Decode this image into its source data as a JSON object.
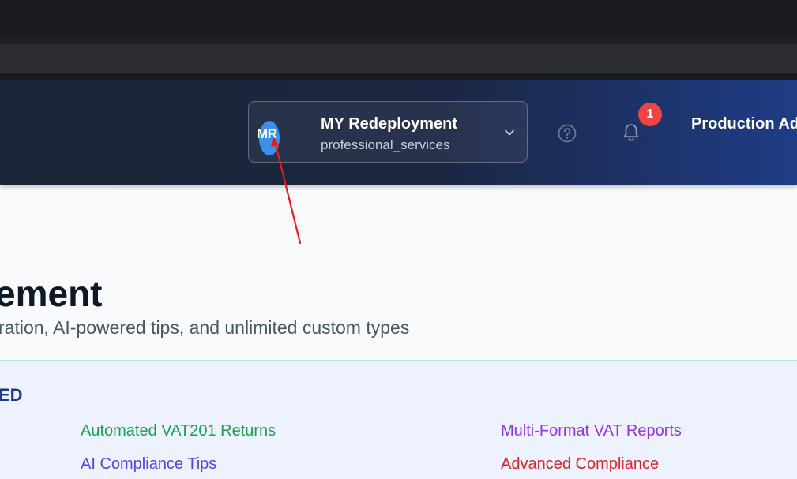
{
  "header": {
    "org_switcher": {
      "avatar_initials": "MR",
      "name": "MY Redeployment",
      "type": "professional_services"
    },
    "notifications": {
      "count": "1"
    },
    "environment_label": "Production Ad",
    "icons": [
      "help-icon",
      "bell-icon",
      "chevron-down-icon"
    ]
  },
  "main": {
    "title": "ement",
    "subtitle": "ration, AI-powered tips, and unlimited custom types",
    "features": {
      "heading": "ED",
      "items": [
        {
          "label": "Automated VAT201 Returns",
          "color": "#16a34a"
        },
        {
          "label": "Multi-Format VAT Reports",
          "color": "#9333ea"
        },
        {
          "label": "AI Compliance Tips",
          "color": "#4f46e5"
        },
        {
          "label": "Advanced Compliance",
          "color": "#dc2626"
        }
      ]
    }
  },
  "colors": {
    "header_start": "#1b2538",
    "header_end": "#1f3c86",
    "annotation_arrow": "#e11d1d"
  }
}
